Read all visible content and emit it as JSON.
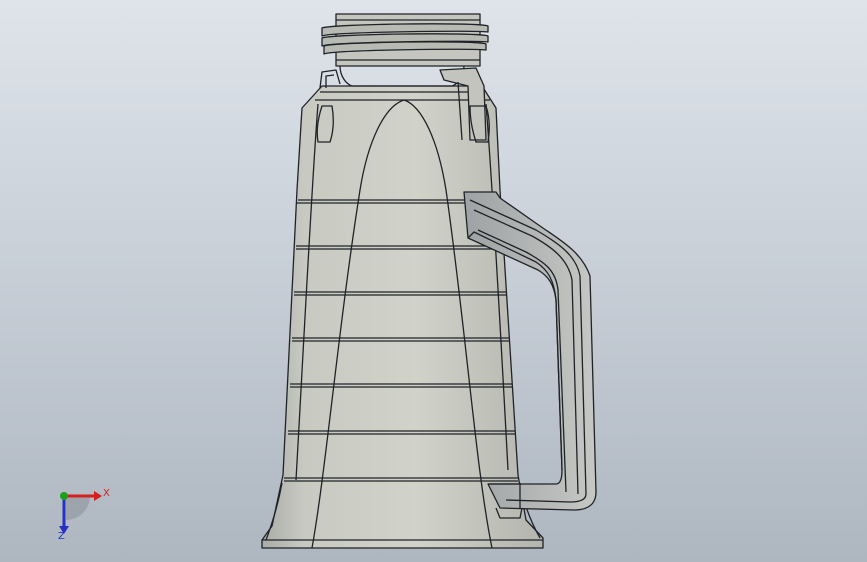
{
  "viewport": {
    "background_top": "#dfe4ea",
    "background_bottom": "#aeb6c0"
  },
  "model": {
    "name": "bottle-with-handle",
    "edge_color": "#1f2327",
    "body_tint": "#c9cbc2"
  },
  "triad": {
    "x_label": "X",
    "z_label": "Z",
    "x_color": "#d42020",
    "y_color": "#1aa01a",
    "z_color": "#2430c8"
  }
}
